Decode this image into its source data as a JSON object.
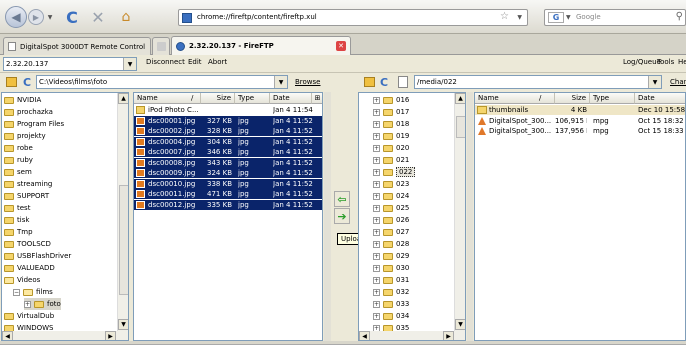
{
  "browser": {
    "url": "chrome://fireftp/content/fireftp.xul",
    "search_placeholder": "Google"
  },
  "tabs": [
    {
      "label": "DigitalSpot 3000DT Remote Control"
    },
    {
      "label": "2.32.20.137 - FireFTP"
    }
  ],
  "menubar": {
    "host": "2.32.20.137",
    "disconnect": "Disconnect",
    "edit": "Edit",
    "abort": "Abort",
    "logqueue": "Log/Queue",
    "tools": "Tools",
    "help": "He"
  },
  "local": {
    "path": "C:\\Videos\\films\\foto",
    "browse": "Browse",
    "tree": [
      "NVIDIA",
      "prochazka",
      "Program Files",
      "projekty",
      "robe",
      "ruby",
      "sem",
      "streaming",
      "SUPPORT",
      "test",
      "tisk",
      "Tmp",
      "TOOLSCD",
      "USBFlashDriver",
      "VALUEADD",
      "Videos",
      "films",
      "foto",
      "VirtualDub",
      "WINDOWS"
    ],
    "columns": {
      "name": "Name",
      "size": "Size",
      "type": "Type",
      "date": "Date"
    },
    "files": [
      {
        "name": "iPod Photo C...",
        "size": "",
        "type": "",
        "date": "Jan 4 11:54"
      },
      {
        "name": "dsc00001.jpg",
        "size": "327 KB",
        "type": "jpg",
        "date": "Jan 4 11:52"
      },
      {
        "name": "dsc00002.jpg",
        "size": "328 KB",
        "type": "jpg",
        "date": "Jan 4 11:52"
      },
      {
        "name": "dsc00004.jpg",
        "size": "304 KB",
        "type": "jpg",
        "date": "Jan 4 11:52"
      },
      {
        "name": "dsc00007.jpg",
        "size": "346 KB",
        "type": "jpg",
        "date": "Jan 4 11:52"
      },
      {
        "name": "dsc00008.jpg",
        "size": "343 KB",
        "type": "jpg",
        "date": "Jan 4 11:52"
      },
      {
        "name": "dsc00009.jpg",
        "size": "324 KB",
        "type": "jpg",
        "date": "Jan 4 11:52"
      },
      {
        "name": "dsc00010.jpg",
        "size": "338 KB",
        "type": "jpg",
        "date": "Jan 4 11:52"
      },
      {
        "name": "dsc00011.jpg",
        "size": "471 KB",
        "type": "jpg",
        "date": "Jan 4 11:52"
      },
      {
        "name": "dsc00012.jpg",
        "size": "335 KB",
        "type": "jpg",
        "date": "Jan 4 11:52"
      }
    ]
  },
  "remote": {
    "path": "/media/022",
    "change": "Chan",
    "tree": [
      "016",
      "017",
      "018",
      "019",
      "020",
      "021",
      "022",
      "023",
      "024",
      "025",
      "026",
      "027",
      "028",
      "029",
      "030",
      "031",
      "032",
      "033",
      "034",
      "035"
    ],
    "columns": {
      "name": "Name",
      "size": "Size",
      "type": "Type",
      "date": "Date"
    },
    "files": [
      {
        "name": "thumbnails",
        "size": "4 KB",
        "type": "",
        "date": "Dec 10 15:58"
      },
      {
        "name": "DigitalSpot_300...",
        "size": "106,915 K...",
        "type": "mpg",
        "date": "Oct 15 18:32"
      },
      {
        "name": "DigitalSpot_300...",
        "size": "137,956 K...",
        "type": "mpg",
        "date": "Oct 15 18:33"
      }
    ]
  },
  "tooltip": "Upload",
  "colors": {
    "selection": "#0a246a",
    "accent": "#2a9d2a"
  }
}
